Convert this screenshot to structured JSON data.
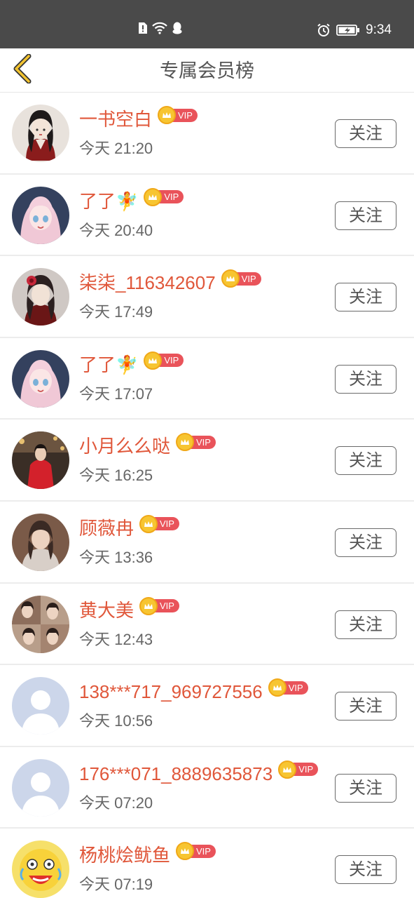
{
  "status_bar": {
    "time": "9:34"
  },
  "header": {
    "title": "专属会员榜"
  },
  "vip_label": "VIP",
  "members": [
    {
      "name": "一书空白",
      "time": "今天 21:20",
      "follow_label": "关注",
      "avatar": "anime-girl-red-dress"
    },
    {
      "name": "了了🧚",
      "time": "今天 20:40",
      "follow_label": "关注",
      "avatar": "anime-pink-hair"
    },
    {
      "name": "柒柒_116342607",
      "time": "今天 17:49",
      "follow_label": "关注",
      "avatar": "anime-dark-hair-flower"
    },
    {
      "name": "了了🧚",
      "time": "今天 17:07",
      "follow_label": "关注",
      "avatar": "anime-pink-hair"
    },
    {
      "name": "小月么么哒",
      "time": "今天 16:25",
      "follow_label": "关注",
      "avatar": "photo-red-coat"
    },
    {
      "name": "顾薇冉",
      "time": "今天 13:36",
      "follow_label": "关注",
      "avatar": "photo-girl"
    },
    {
      "name": "黄大美",
      "time": "今天 12:43",
      "follow_label": "关注",
      "avatar": "photo-group"
    },
    {
      "name": "138***717_969727556",
      "time": "今天 10:56",
      "follow_label": "关注",
      "avatar": "default-avatar"
    },
    {
      "name": "176***071_8889635873",
      "time": "今天 07:20",
      "follow_label": "关注",
      "avatar": "default-avatar"
    },
    {
      "name": "杨桃烩鱿鱼",
      "time": "今天 07:19",
      "follow_label": "关注",
      "avatar": "cartoon-crying-face"
    }
  ]
}
